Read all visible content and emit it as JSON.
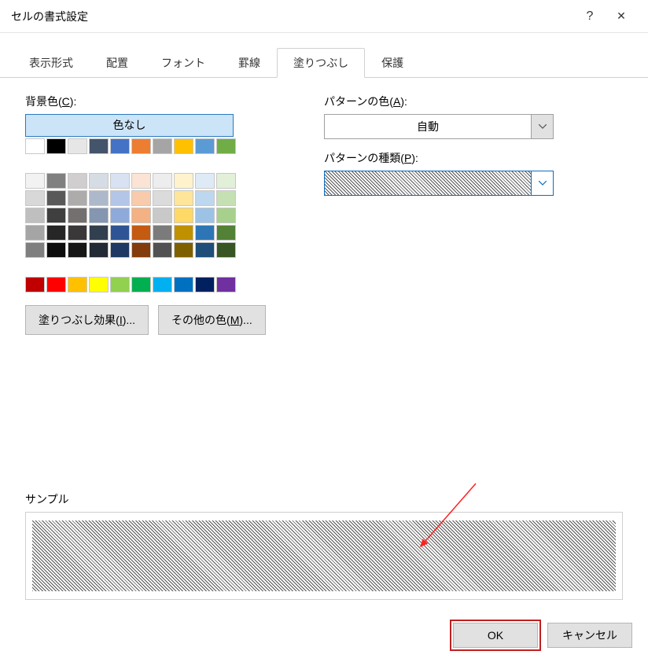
{
  "window": {
    "title": "セルの書式設定",
    "help": "?",
    "close": "✕"
  },
  "tabs": [
    {
      "label": "表示形式",
      "active": false
    },
    {
      "label": "配置",
      "active": false
    },
    {
      "label": "フォント",
      "active": false
    },
    {
      "label": "罫線",
      "active": false
    },
    {
      "label": "塗りつぶし",
      "active": true
    },
    {
      "label": "保護",
      "active": false
    }
  ],
  "fill": {
    "bgcolor_label": "背景色(",
    "bgcolor_accel": "C",
    "bgcolor_label_end": "):",
    "no_color": "色なし",
    "fill_effects_label": "塗りつぶし効果(",
    "fill_effects_accel": "I",
    "fill_effects_end": ")...",
    "more_colors_label": "その他の色(",
    "more_colors_accel": "M",
    "more_colors_end": ")...",
    "theme_colors_row1": [
      "#ffffff",
      "#000000",
      "#e7e6e6",
      "#44546a",
      "#4472c4",
      "#ed7d31",
      "#a5a5a5",
      "#ffc000",
      "#5b9bd5",
      "#70ad47"
    ],
    "theme_tints": [
      [
        "#f2f2f2",
        "#808080",
        "#d0cece",
        "#d6dce4",
        "#d9e2f3",
        "#fbe4d5",
        "#ededed",
        "#fff2cc",
        "#deebf6",
        "#e2efd9"
      ],
      [
        "#d8d8d8",
        "#595959",
        "#aeabab",
        "#adb9ca",
        "#b4c6e7",
        "#f7cbac",
        "#dbdbdb",
        "#fee599",
        "#bdd7ee",
        "#c5e0b3"
      ],
      [
        "#bfbfbf",
        "#3f3f3f",
        "#757070",
        "#8496b0",
        "#8eaadb",
        "#f4b183",
        "#c9c9c9",
        "#ffd965",
        "#9cc3e5",
        "#a8d08d"
      ],
      [
        "#a5a5a5",
        "#262626",
        "#3a3838",
        "#323f4f",
        "#2f5496",
        "#c55a11",
        "#7b7b7b",
        "#bf9000",
        "#2e75b5",
        "#538135"
      ],
      [
        "#7f7f7f",
        "#0c0c0c",
        "#171616",
        "#222a35",
        "#1f3864",
        "#833c0b",
        "#525252",
        "#7f6000",
        "#1e4e79",
        "#375623"
      ]
    ],
    "standard_colors": [
      "#c00000",
      "#ff0000",
      "#ffc000",
      "#ffff00",
      "#92d050",
      "#00b050",
      "#00b0f0",
      "#0070c0",
      "#002060",
      "#7030a0"
    ]
  },
  "pattern": {
    "color_label": "パターンの色(",
    "color_accel": "A",
    "color_end": "):",
    "color_value": "自動",
    "style_label": "パターンの種類(",
    "style_accel": "P",
    "style_end": "):",
    "style_value": "diagonal-hatch"
  },
  "sample": {
    "label": "サンプル"
  },
  "footer": {
    "ok": "OK",
    "cancel": "キャンセル"
  }
}
